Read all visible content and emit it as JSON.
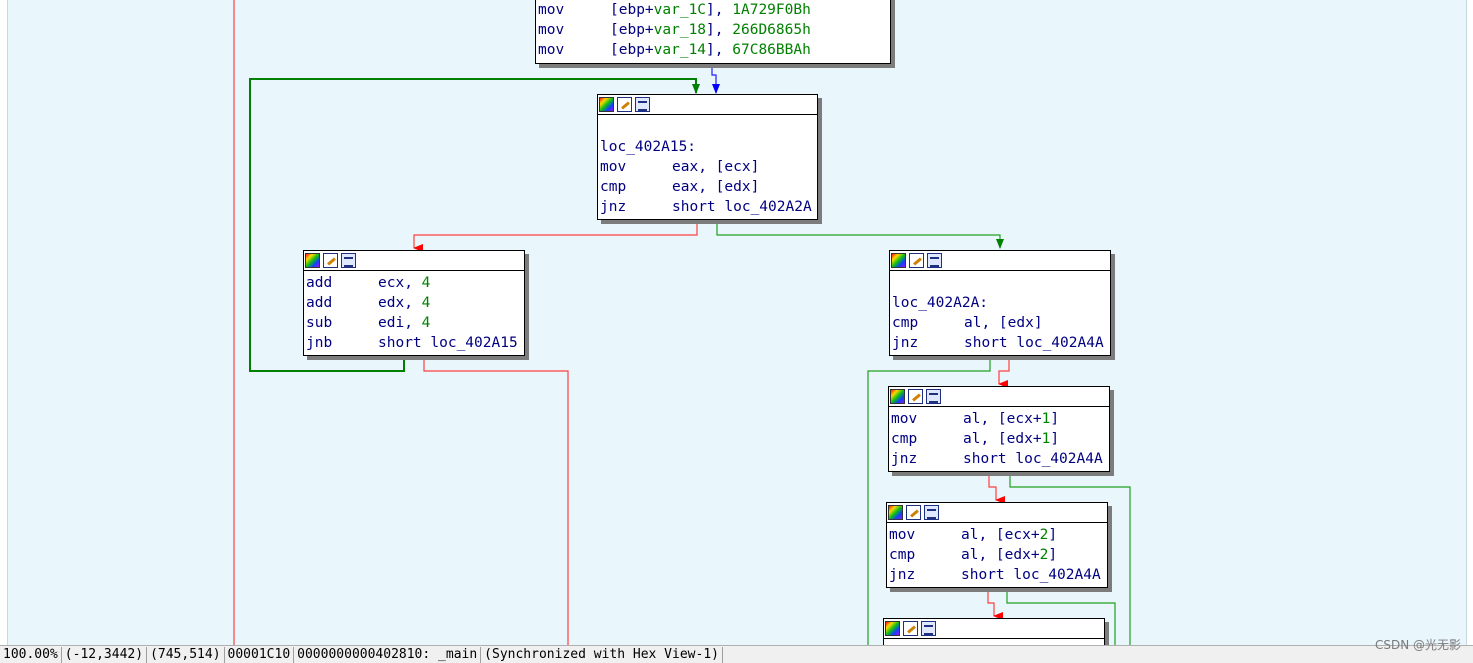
{
  "blocks": {
    "top": {
      "lines": [
        {
          "m": "mov",
          "a": "[ebp+",
          "v": "var_1C",
          "b": "], ",
          "n": "1A729F0Bh"
        },
        {
          "m": "mov",
          "a": "[ebp+",
          "v": "var_18",
          "b": "], ",
          "n": "266D6865h"
        },
        {
          "m": "mov",
          "a": "[ebp+",
          "v": "var_14",
          "b": "], ",
          "n": "67C86BBAh"
        }
      ]
    },
    "loop": {
      "label": "loc_402A15:",
      "lines": [
        {
          "m": "mov",
          "o": "eax, [ecx]"
        },
        {
          "m": "cmp",
          "o": "eax, [edx]"
        },
        {
          "m": "jnz",
          "o": "short loc_402A2A"
        }
      ]
    },
    "add": {
      "lines": [
        {
          "m": "add",
          "o": "ecx, ",
          "n": "4"
        },
        {
          "m": "add",
          "o": "edx, ",
          "n": "4"
        },
        {
          "m": "sub",
          "o": "edi, ",
          "n": "4"
        },
        {
          "m": "jnb",
          "o": "short loc_402A15"
        }
      ]
    },
    "cmp0": {
      "label": "loc_402A2A:",
      "lines": [
        {
          "m": "cmp",
          "o": "al, [edx]"
        },
        {
          "m": "jnz",
          "o": "short loc_402A4A"
        }
      ]
    },
    "cmp1": {
      "lines": [
        {
          "m": "mov",
          "o": "al, [ecx+",
          "n": "1",
          "o2": "]"
        },
        {
          "m": "cmp",
          "o": "al, [edx+",
          "n": "1",
          "o2": "]"
        },
        {
          "m": "jnz",
          "o": "short loc_402A4A"
        }
      ]
    },
    "cmp2": {
      "lines": [
        {
          "m": "mov",
          "o": "al, [ecx+",
          "n": "2",
          "o2": "]"
        },
        {
          "m": "cmp",
          "o": "al, [edx+",
          "n": "2",
          "o2": "]"
        },
        {
          "m": "jnz",
          "o": "short loc_402A4A"
        }
      ]
    }
  },
  "status": {
    "zoom": "100.00%",
    "coords": "(-12,3442)",
    "mouse": "(745,514)",
    "offset": "00001C10",
    "address": "0000000000402810: _main",
    "sync": "(Synchronized with Hex View-1)"
  },
  "watermark": "CSDN @光无影",
  "colors": {
    "true_edge": "#008000",
    "false_edge": "#ff0000",
    "flow_edge": "#0000ff",
    "canvas": "#e9f6fc"
  }
}
